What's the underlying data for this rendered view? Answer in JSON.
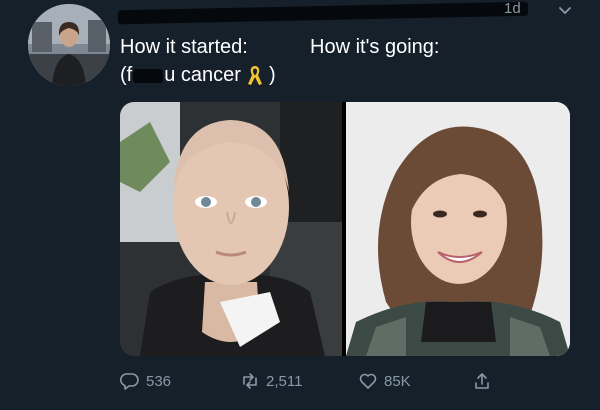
{
  "tweet": {
    "timestamp": "1d",
    "text_line1_a": "How it started:",
    "text_line1_b": "How it's going:",
    "text_line2_start": "(f",
    "text_line2_end": "u cancer",
    "text_line2_close": ")"
  },
  "media": {
    "left_photo": "before-photo",
    "right_photo": "after-photo"
  },
  "actions": {
    "replies": "536",
    "retweets": "2,511",
    "likes": "85K"
  },
  "icons": {
    "reply": "reply-icon",
    "retweet": "retweet-icon",
    "like": "heart-icon",
    "share": "share-icon",
    "more": "chevron-down-icon",
    "ribbon": "gold-ribbon-icon"
  },
  "colors": {
    "background": "#15202b",
    "muted": "#8899a6",
    "ribbon": "#f2c230"
  }
}
